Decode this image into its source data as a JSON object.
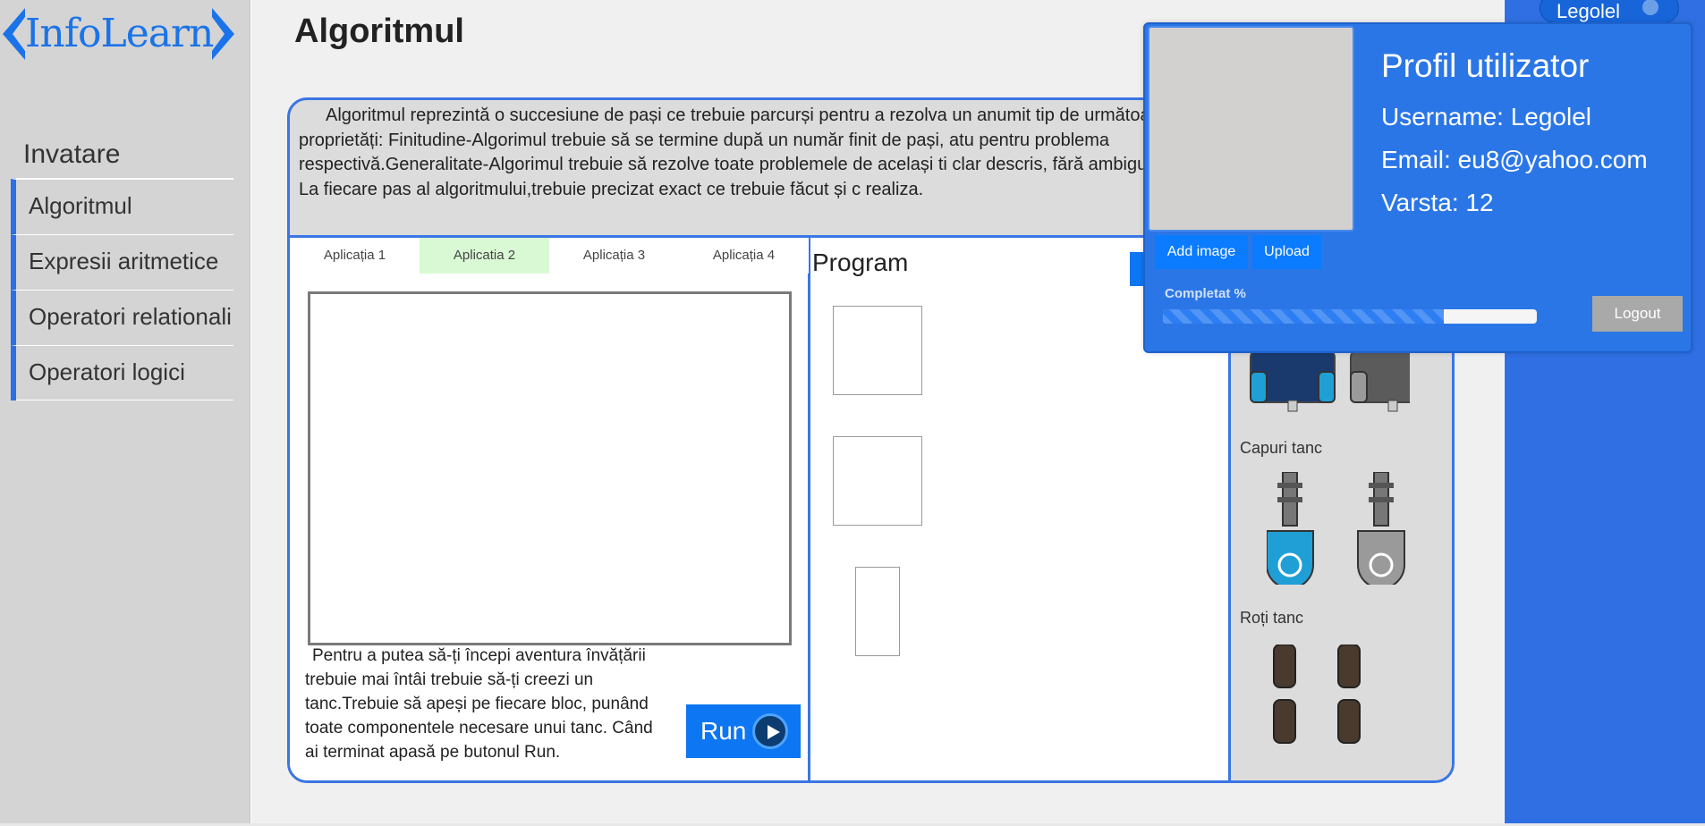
{
  "logo": {
    "text": "InfoLearn"
  },
  "sidebar": {
    "section_title": "Invatare",
    "items": [
      {
        "label": "Algoritmul"
      },
      {
        "label": "Expresii aritmetice"
      },
      {
        "label": "Operatori relationali"
      },
      {
        "label": "Operatori logici"
      }
    ]
  },
  "page": {
    "title": "Algoritmul",
    "intro": "Algoritmul reprezintă o succesiune de pași ce trebuie parcurși pentru a rezolva un anumit tip de următoarele proprietăți: Finitudine-Algorimul trebuie să se termine după un număr finit de pași, atu pentru problema respectivă.Generalitate-Algorimul trebuie să rezolve toate problemele de același ti clar descris, fără ambiguități. La fiecare pas al algoritmului,trebuie precizat exact ce trebuie făcut și c realiza."
  },
  "tabs": [
    {
      "label": "Aplicația 1",
      "bg": "#ffffff"
    },
    {
      "label": "Aplicatia 2",
      "bg": "#d9f9d4"
    },
    {
      "label": "Aplicația 3",
      "bg": "#ffffff"
    },
    {
      "label": "Aplicația 4",
      "bg": "#ffffff"
    }
  ],
  "app": {
    "description": "Pentru a putea să-ți începi aventura învățării trebuie mai întâi trebuie să-ți creezi un tanc.Trebuie să apeși pe fiecare bloc, punând toate componentele necesare unui tanc. Când ai terminat apasă pe butonul Run.",
    "run_label": "Run"
  },
  "program": {
    "title": "Program"
  },
  "parts": {
    "heads_label": "Capuri tanc",
    "wheels_label": "Roți tanc"
  },
  "profile": {
    "title": "Profil utilizator",
    "username": "Username: Legolel",
    "email": "Email: eu8@yahoo.com",
    "age": "Varsta: 12",
    "add_image": "Add image",
    "upload": "Upload",
    "progress_label": "Completat %",
    "progress_fraction": 0.75,
    "logout": "Logout"
  },
  "user_menu": {
    "name": "Legolel"
  },
  "colors": {
    "accent": "#2d6fe6",
    "primary_button": "#0d76f2",
    "tank_blue": "#1f9fd6",
    "tank_gray": "#9a9a9a"
  }
}
